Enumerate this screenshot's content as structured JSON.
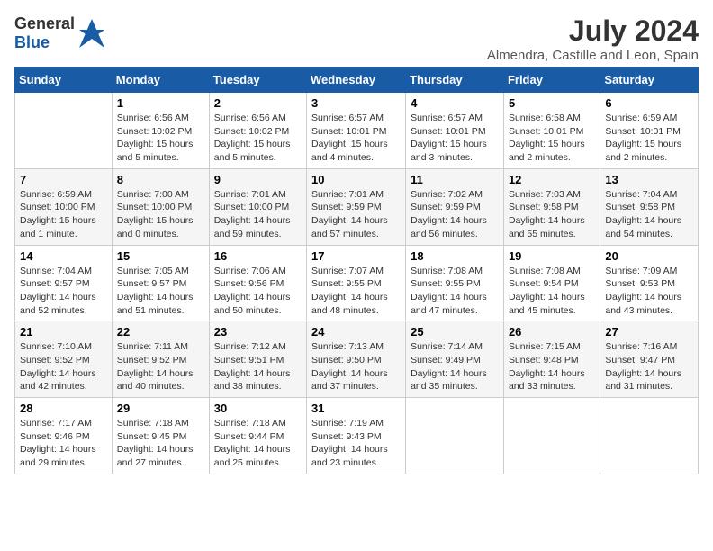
{
  "header": {
    "logo_general": "General",
    "logo_blue": "Blue",
    "title": "July 2024",
    "subtitle": "Almendra, Castille and Leon, Spain"
  },
  "days_of_week": [
    "Sunday",
    "Monday",
    "Tuesday",
    "Wednesday",
    "Thursday",
    "Friday",
    "Saturday"
  ],
  "weeks": [
    [
      {
        "day": "",
        "sunrise": "",
        "sunset": "",
        "daylight": ""
      },
      {
        "day": "1",
        "sunrise": "Sunrise: 6:56 AM",
        "sunset": "Sunset: 10:02 PM",
        "daylight": "Daylight: 15 hours and 5 minutes."
      },
      {
        "day": "2",
        "sunrise": "Sunrise: 6:56 AM",
        "sunset": "Sunset: 10:02 PM",
        "daylight": "Daylight: 15 hours and 5 minutes."
      },
      {
        "day": "3",
        "sunrise": "Sunrise: 6:57 AM",
        "sunset": "Sunset: 10:01 PM",
        "daylight": "Daylight: 15 hours and 4 minutes."
      },
      {
        "day": "4",
        "sunrise": "Sunrise: 6:57 AM",
        "sunset": "Sunset: 10:01 PM",
        "daylight": "Daylight: 15 hours and 3 minutes."
      },
      {
        "day": "5",
        "sunrise": "Sunrise: 6:58 AM",
        "sunset": "Sunset: 10:01 PM",
        "daylight": "Daylight: 15 hours and 2 minutes."
      },
      {
        "day": "6",
        "sunrise": "Sunrise: 6:59 AM",
        "sunset": "Sunset: 10:01 PM",
        "daylight": "Daylight: 15 hours and 2 minutes."
      }
    ],
    [
      {
        "day": "7",
        "sunrise": "Sunrise: 6:59 AM",
        "sunset": "Sunset: 10:00 PM",
        "daylight": "Daylight: 15 hours and 1 minute."
      },
      {
        "day": "8",
        "sunrise": "Sunrise: 7:00 AM",
        "sunset": "Sunset: 10:00 PM",
        "daylight": "Daylight: 15 hours and 0 minutes."
      },
      {
        "day": "9",
        "sunrise": "Sunrise: 7:01 AM",
        "sunset": "Sunset: 10:00 PM",
        "daylight": "Daylight: 14 hours and 59 minutes."
      },
      {
        "day": "10",
        "sunrise": "Sunrise: 7:01 AM",
        "sunset": "Sunset: 9:59 PM",
        "daylight": "Daylight: 14 hours and 57 minutes."
      },
      {
        "day": "11",
        "sunrise": "Sunrise: 7:02 AM",
        "sunset": "Sunset: 9:59 PM",
        "daylight": "Daylight: 14 hours and 56 minutes."
      },
      {
        "day": "12",
        "sunrise": "Sunrise: 7:03 AM",
        "sunset": "Sunset: 9:58 PM",
        "daylight": "Daylight: 14 hours and 55 minutes."
      },
      {
        "day": "13",
        "sunrise": "Sunrise: 7:04 AM",
        "sunset": "Sunset: 9:58 PM",
        "daylight": "Daylight: 14 hours and 54 minutes."
      }
    ],
    [
      {
        "day": "14",
        "sunrise": "Sunrise: 7:04 AM",
        "sunset": "Sunset: 9:57 PM",
        "daylight": "Daylight: 14 hours and 52 minutes."
      },
      {
        "day": "15",
        "sunrise": "Sunrise: 7:05 AM",
        "sunset": "Sunset: 9:57 PM",
        "daylight": "Daylight: 14 hours and 51 minutes."
      },
      {
        "day": "16",
        "sunrise": "Sunrise: 7:06 AM",
        "sunset": "Sunset: 9:56 PM",
        "daylight": "Daylight: 14 hours and 50 minutes."
      },
      {
        "day": "17",
        "sunrise": "Sunrise: 7:07 AM",
        "sunset": "Sunset: 9:55 PM",
        "daylight": "Daylight: 14 hours and 48 minutes."
      },
      {
        "day": "18",
        "sunrise": "Sunrise: 7:08 AM",
        "sunset": "Sunset: 9:55 PM",
        "daylight": "Daylight: 14 hours and 47 minutes."
      },
      {
        "day": "19",
        "sunrise": "Sunrise: 7:08 AM",
        "sunset": "Sunset: 9:54 PM",
        "daylight": "Daylight: 14 hours and 45 minutes."
      },
      {
        "day": "20",
        "sunrise": "Sunrise: 7:09 AM",
        "sunset": "Sunset: 9:53 PM",
        "daylight": "Daylight: 14 hours and 43 minutes."
      }
    ],
    [
      {
        "day": "21",
        "sunrise": "Sunrise: 7:10 AM",
        "sunset": "Sunset: 9:52 PM",
        "daylight": "Daylight: 14 hours and 42 minutes."
      },
      {
        "day": "22",
        "sunrise": "Sunrise: 7:11 AM",
        "sunset": "Sunset: 9:52 PM",
        "daylight": "Daylight: 14 hours and 40 minutes."
      },
      {
        "day": "23",
        "sunrise": "Sunrise: 7:12 AM",
        "sunset": "Sunset: 9:51 PM",
        "daylight": "Daylight: 14 hours and 38 minutes."
      },
      {
        "day": "24",
        "sunrise": "Sunrise: 7:13 AM",
        "sunset": "Sunset: 9:50 PM",
        "daylight": "Daylight: 14 hours and 37 minutes."
      },
      {
        "day": "25",
        "sunrise": "Sunrise: 7:14 AM",
        "sunset": "Sunset: 9:49 PM",
        "daylight": "Daylight: 14 hours and 35 minutes."
      },
      {
        "day": "26",
        "sunrise": "Sunrise: 7:15 AM",
        "sunset": "Sunset: 9:48 PM",
        "daylight": "Daylight: 14 hours and 33 minutes."
      },
      {
        "day": "27",
        "sunrise": "Sunrise: 7:16 AM",
        "sunset": "Sunset: 9:47 PM",
        "daylight": "Daylight: 14 hours and 31 minutes."
      }
    ],
    [
      {
        "day": "28",
        "sunrise": "Sunrise: 7:17 AM",
        "sunset": "Sunset: 9:46 PM",
        "daylight": "Daylight: 14 hours and 29 minutes."
      },
      {
        "day": "29",
        "sunrise": "Sunrise: 7:18 AM",
        "sunset": "Sunset: 9:45 PM",
        "daylight": "Daylight: 14 hours and 27 minutes."
      },
      {
        "day": "30",
        "sunrise": "Sunrise: 7:18 AM",
        "sunset": "Sunset: 9:44 PM",
        "daylight": "Daylight: 14 hours and 25 minutes."
      },
      {
        "day": "31",
        "sunrise": "Sunrise: 7:19 AM",
        "sunset": "Sunset: 9:43 PM",
        "daylight": "Daylight: 14 hours and 23 minutes."
      },
      {
        "day": "",
        "sunrise": "",
        "sunset": "",
        "daylight": ""
      },
      {
        "day": "",
        "sunrise": "",
        "sunset": "",
        "daylight": ""
      },
      {
        "day": "",
        "sunrise": "",
        "sunset": "",
        "daylight": ""
      }
    ]
  ]
}
